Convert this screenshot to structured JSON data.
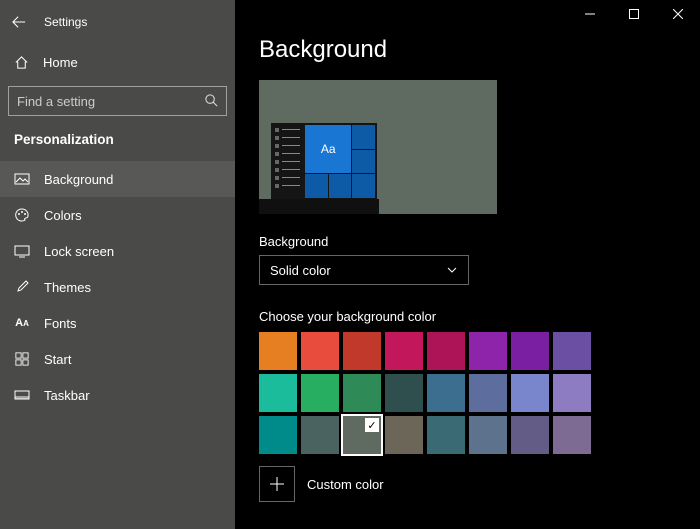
{
  "window_title": "Settings",
  "home_label": "Home",
  "search_placeholder": "Find a setting",
  "category": "Personalization",
  "sidebar": {
    "items": [
      {
        "label": "Background",
        "active": true
      },
      {
        "label": "Colors"
      },
      {
        "label": "Lock screen"
      },
      {
        "label": "Themes"
      },
      {
        "label": "Fonts"
      },
      {
        "label": "Start"
      },
      {
        "label": "Taskbar"
      }
    ]
  },
  "page": {
    "title": "Background",
    "preview_sample_text": "Aa",
    "bg_field_label": "Background",
    "bg_field_value": "Solid color",
    "choose_label": "Choose your background color",
    "custom_label": "Custom color"
  },
  "colors": [
    "#e67e22",
    "#e74c3c",
    "#c0392b",
    "#c2185b",
    "#ad1457",
    "#8e24aa",
    "#7b1fa2",
    "#6a4fa3",
    "#1abc9c",
    "#27ae60",
    "#2e8b57",
    "#2f4f4f",
    "#3b6e8f",
    "#5d6d9e",
    "#7986cb",
    "#8e7cc3",
    "#008b8b",
    "#4a6360",
    "#5f6a60",
    "#6b6658",
    "#3a6a74",
    "#5d738d",
    "#635c87",
    "#7d6b94"
  ],
  "selected_color_index": 18,
  "preview_bg": "#5f6a60",
  "preview_accent": "#1976d2"
}
